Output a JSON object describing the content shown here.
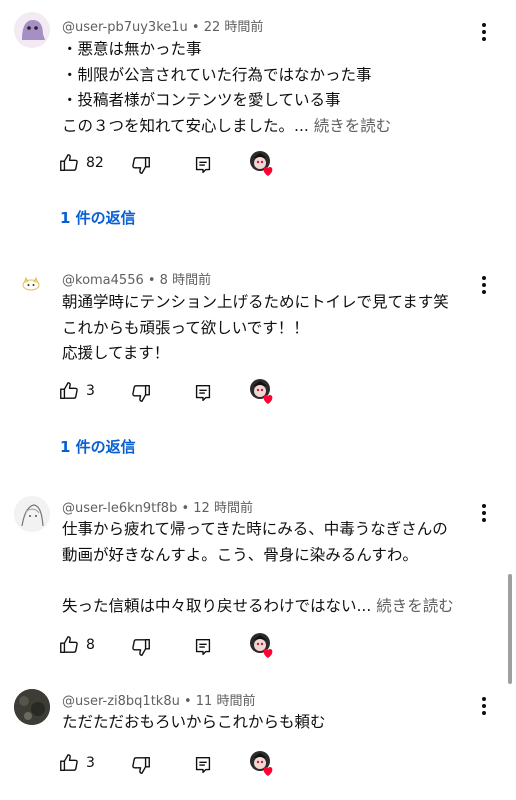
{
  "comments": [
    {
      "author": "@user-pb7uy3ke1u",
      "time": "22 時間前",
      "lines": [
        "・悪意は無かった事",
        "・制限が公言されていた行為ではなかった事",
        "・投稿者様がコンテンツを愛している事",
        "この３つを知れて安心しました。..."
      ],
      "read_more": "続きを読む",
      "likes": "82",
      "replies": "1 件の返信"
    },
    {
      "author": "@koma4556",
      "time": "8 時間前",
      "lines": [
        "朝通学時にテンション上げるためにトイレで見てます笑",
        "これからも頑張って欲しいです！！",
        "応援してます！"
      ],
      "likes": "3",
      "replies": "1 件の返信"
    },
    {
      "author": "@user-le6kn9tf8b",
      "time": "12 時間前",
      "lines": [
        "仕事から疲れて帰ってきた時にみる、中毒うなぎさんの",
        "動画が好きなんすよ。こう、骨身に染みるんすわ。",
        "",
        "失った信頼は中々取り戻せるわけではない..."
      ],
      "read_more": "続きを読む",
      "likes": "8"
    },
    {
      "author": "@user-zi8bq1tk8u",
      "time": "11 時間前",
      "lines": [
        "ただただおもろいからこれからも頼む"
      ],
      "likes": "3"
    }
  ],
  "separator": " • ",
  "icons": {
    "like": "thumbs-up-icon",
    "dislike": "thumbs-down-icon",
    "reply": "reply-comment-icon",
    "creator_heart": "creator-heart-icon",
    "more": "more-vertical-icon"
  },
  "colors": {
    "link": "#065fd4",
    "meta": "#606060",
    "heart": "#ff0033"
  }
}
